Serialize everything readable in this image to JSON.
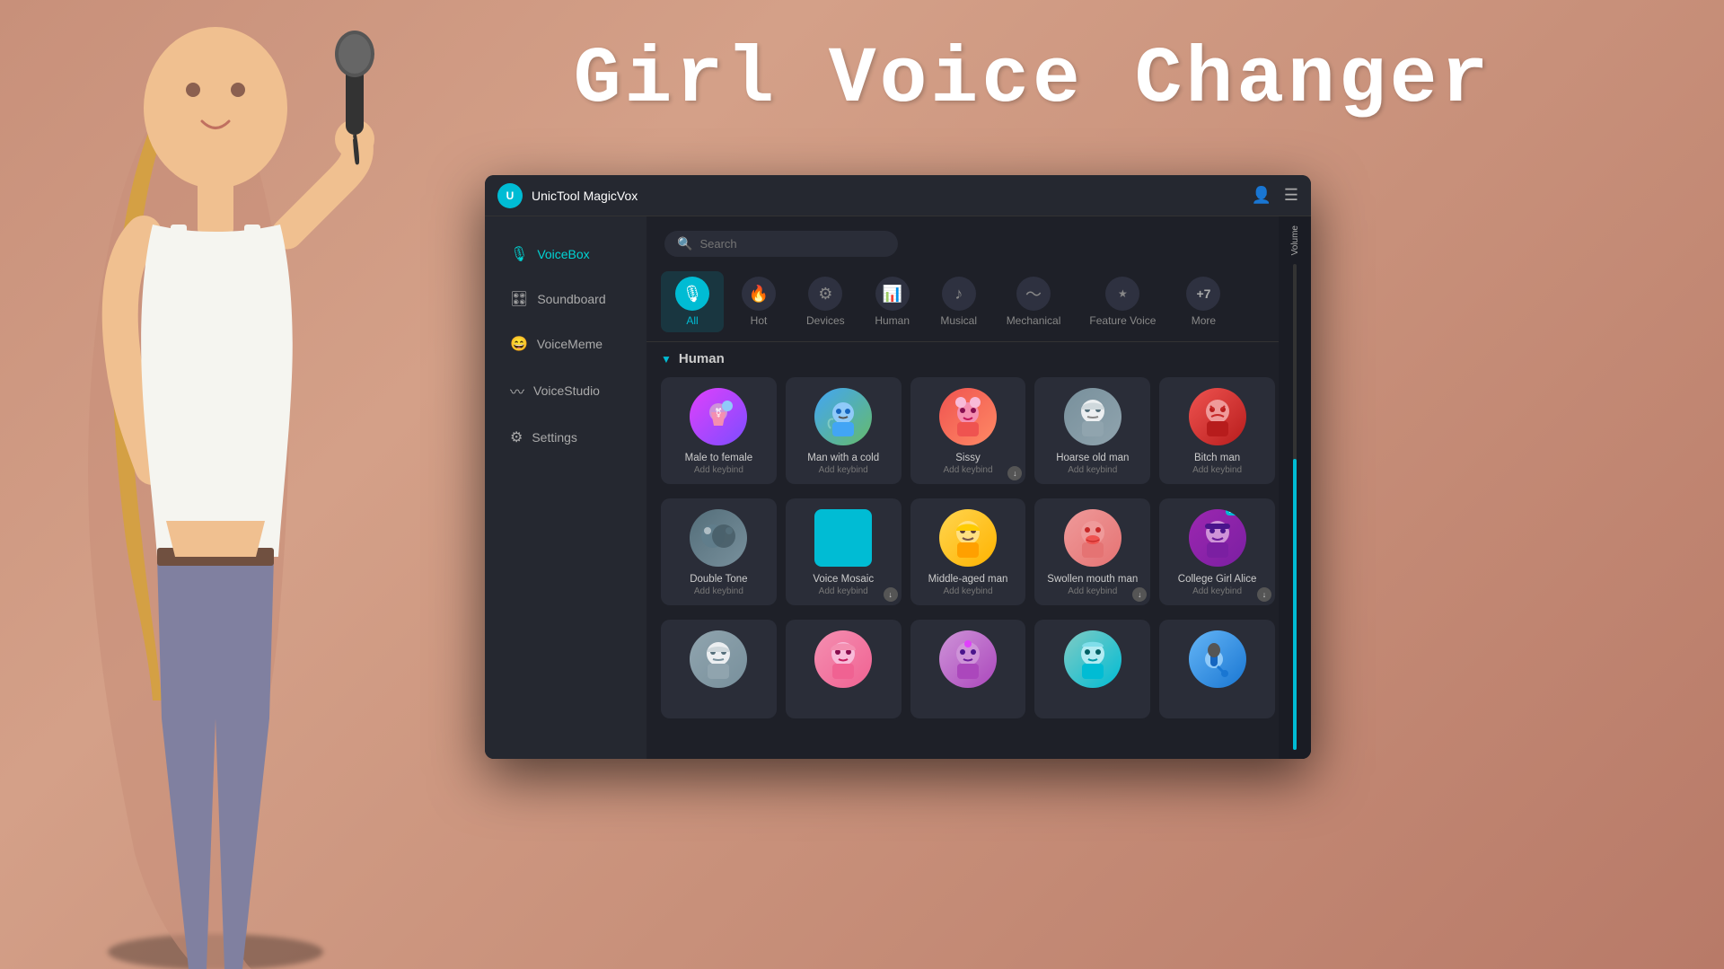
{
  "page": {
    "title": "Girl Voice Changer",
    "bg_color": "#c8907a"
  },
  "app": {
    "name": "UnicTool MagicVox",
    "icon": "U"
  },
  "sidebar": {
    "items": [
      {
        "id": "voicebox",
        "label": "VoiceBox",
        "icon": "🎙",
        "active": true
      },
      {
        "id": "soundboard",
        "label": "Soundboard",
        "icon": "🎛",
        "active": false
      },
      {
        "id": "voicememe",
        "label": "VoiceMeme",
        "icon": "😄",
        "active": false
      },
      {
        "id": "voicestudio",
        "label": "VoiceStudio",
        "icon": "⚙",
        "active": false
      },
      {
        "id": "settings",
        "label": "Settings",
        "icon": "⚙",
        "active": false
      }
    ]
  },
  "search": {
    "placeholder": "Search"
  },
  "categories": [
    {
      "id": "all",
      "label": "All",
      "icon": "🎙",
      "active": true
    },
    {
      "id": "hot",
      "label": "Hot",
      "icon": "🔥",
      "active": false
    },
    {
      "id": "devices",
      "label": "Devices",
      "icon": "⚙",
      "active": false
    },
    {
      "id": "human",
      "label": "Human",
      "icon": "📊",
      "active": false
    },
    {
      "id": "musical",
      "label": "Musical",
      "icon": "♪",
      "active": false
    },
    {
      "id": "mechanical",
      "label": "Mechanical",
      "icon": "〜",
      "active": false
    },
    {
      "id": "feature_voice",
      "label": "Feature Voice",
      "icon": "★",
      "active": false
    },
    {
      "id": "more",
      "label": "More",
      "icon": "+7",
      "active": false
    }
  ],
  "section": {
    "label": "Human"
  },
  "voice_cards_row1": [
    {
      "name": "Male to female",
      "keybind": "Add keybind",
      "avatar_type": "male-female",
      "emoji": "⚧"
    },
    {
      "name": "Man with a cold",
      "keybind": "Add keybind",
      "avatar_type": "man-cold",
      "emoji": "🤧"
    },
    {
      "name": "Sissy",
      "keybind": "Add keybind",
      "avatar_type": "sissy",
      "emoji": "💃",
      "has_download": true
    },
    {
      "name": "Hoarse old man",
      "keybind": "Add keybind",
      "avatar_type": "old-man",
      "emoji": "👴"
    },
    {
      "name": "Bitch man",
      "keybind": "Add keybind",
      "avatar_type": "bitch-man",
      "emoji": "😤"
    }
  ],
  "voice_cards_row2": [
    {
      "name": "Double Tone",
      "keybind": "Add keybind",
      "avatar_type": "double-tone",
      "emoji": "🎭"
    },
    {
      "name": "Voice Mosaic",
      "keybind": "Add keybind",
      "avatar_type": "voice-mosaic",
      "emoji": "⬛",
      "has_download": true
    },
    {
      "name": "Middle-aged man",
      "keybind": "Add keybind",
      "avatar_type": "mid-man",
      "emoji": "👨"
    },
    {
      "name": "Swollen mouth man",
      "keybind": "Add keybind",
      "avatar_type": "swollen",
      "emoji": "😮",
      "has_download": true
    },
    {
      "name": "College Girl Alice",
      "keybind": "Add keybind",
      "avatar_type": "college-girl",
      "emoji": "👩‍🎓",
      "is_new": true,
      "has_download": true
    }
  ],
  "voice_cards_row3": [
    {
      "name": "",
      "keybind": "",
      "avatar_type": "row3-1",
      "emoji": "👴"
    },
    {
      "name": "",
      "keybind": "",
      "avatar_type": "row3-2",
      "emoji": "👩"
    },
    {
      "name": "",
      "keybind": "",
      "avatar_type": "row3-3",
      "emoji": "👩‍🦱"
    },
    {
      "name": "",
      "keybind": "",
      "avatar_type": "row3-4",
      "emoji": "🧙"
    },
    {
      "name": "",
      "keybind": "",
      "avatar_type": "row3-5",
      "emoji": "🎤"
    }
  ],
  "volume": {
    "label": "Volume",
    "level": 60
  }
}
